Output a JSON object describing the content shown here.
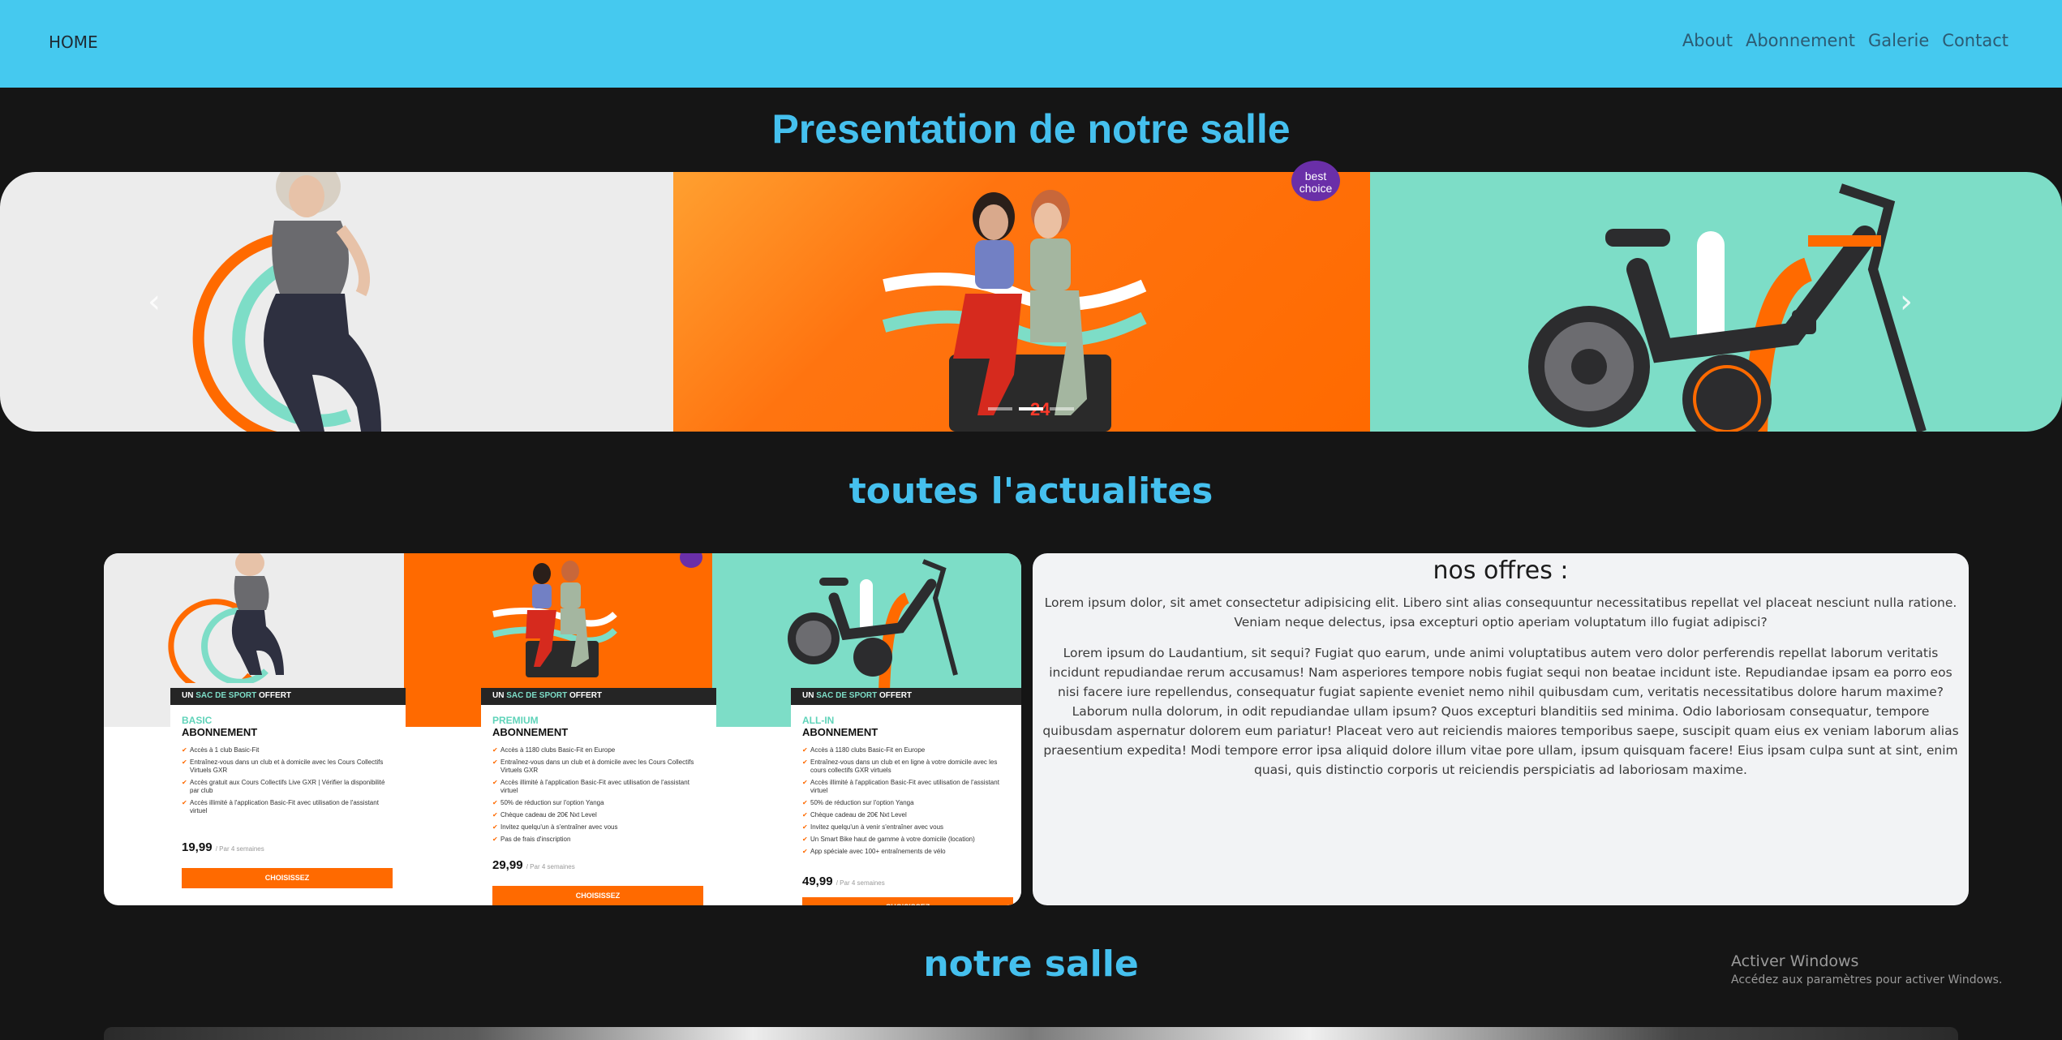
{
  "nav": {
    "home": "HOME",
    "links": [
      "About",
      "Abonnement",
      "Galerie",
      "Contact"
    ]
  },
  "sections": {
    "presentation": "Presentation de notre salle",
    "news": "toutes l'actualites",
    "gym": "notre salle"
  },
  "carousel": {
    "prev": "‹",
    "next": "›",
    "badge": "best choice",
    "slide_count": 3,
    "active_slide": 1,
    "colors": {
      "slide1": "#ececec",
      "slide2": "#ff6a00",
      "slide3": "#7dddc7"
    }
  },
  "offers": {
    "title": "nos offres :",
    "p1": "Lorem ipsum dolor, sit amet consectetur adipisicing elit. Libero sint alias consequuntur necessitatibus repellat vel placeat nesciunt nulla ratione. Veniam neque delectus, ipsa excepturi optio aperiam voluptatum illo fugiat adipisci?",
    "p2": "Lorem ipsum do Laudantium, sit sequi? Fugiat quo earum, unde animi voluptatibus autem vero dolor perferendis repellat laborum veritatis incidunt repudiandae rerum accusamus! Nam asperiores tempore nobis fugiat sequi non beatae incidunt iste. Repudiandae ipsam ea porro eos nisi facere iure repellendus, consequatur fugiat sapiente eveniet nemo nihil quibusdam cum, veritatis necessitatibus dolore harum maxime? Laborum nulla dolorum, in odit repudiandae ullam ipsum? Quos excepturi blanditiis sed minima. Odio laboriosam consequatur, tempore quibusdam aspernatur dolorem eum pariatur! Placeat vero aut reiciendis maiores temporibus saepe, suscipit quam eius ex veniam laborum alias praesentium expedita! Modi tempore error ipsa aliquid dolore illum vitae pore ullam, ipsum quisquam facere! Eius ipsam culpa sunt at sint, enim quasi, quis distinctio corporis ut reiciendis perspiciatis ad laboriosam maxime."
  },
  "plans": [
    {
      "head_pre": "UN ",
      "head_mid": "SAC DE SPORT",
      "head_post": " OFFERT",
      "tier": "BASIC",
      "kind": "ABONNEMENT",
      "features": [
        "Accès à 1 club Basic-Fit",
        "Entraînez-vous dans un club et à domicile avec les Cours Collectifs Virtuels GXR",
        "Accès gratuit aux Cours Collectifs Live GXR | Vérifier la disponibilité par club",
        "Accès illimité à l'application Basic-Fit avec utilisation de l'assistant virtuel"
      ],
      "price": "19,99",
      "period": "/ Par 4 semaines",
      "button": "CHOISISSEZ"
    },
    {
      "head_pre": "UN ",
      "head_mid": "SAC DE SPORT",
      "head_post": " OFFERT",
      "tier": "PREMIUM",
      "kind": "ABONNEMENT",
      "features": [
        "Accès à 1180 clubs Basic-Fit en Europe",
        "Entraînez-vous dans un club et à domicile avec les Cours Collectifs Virtuels GXR",
        "Accès illimité à l'application Basic-Fit avec utilisation de l'assistant virtuel",
        "50% de réduction sur l'option Yanga",
        "Chèque cadeau de 20€ Nxt Level",
        "Invitez quelqu'un à s'entraîner avec vous",
        "Pas de frais d'inscription"
      ],
      "price": "29,99",
      "period": "/ Par 4 semaines",
      "button": "CHOISISSEZ"
    },
    {
      "head_pre": "UN ",
      "head_mid": "SAC DE SPORT",
      "head_post": " OFFERT",
      "tier": "ALL-IN",
      "kind": "ABONNEMENT",
      "features": [
        "Accès à 1180 clubs Basic-Fit en Europe",
        "Entraînez-vous dans un club et en ligne à votre domicile avec les cours collectifs GXR virtuels",
        "Accès illimité à l'application Basic-Fit avec utilisation de l'assistant virtuel",
        "50% de réduction sur l'option Yanga",
        "Chèque cadeau de 20€ Nxt Level",
        "Invitez quelqu'un à venir s'entraîner avec vous",
        "Un Smart Bike haut de gamme à votre domicile (location)",
        "App spéciale avec 100+ entraînements de vélo"
      ],
      "price": "49,99",
      "period": "/ Par 4 semaines",
      "button": "CHOISISSEZ"
    }
  ],
  "watermark": {
    "line1": "Activer Windows",
    "line2": "Accédez aux paramètres pour activer Windows."
  }
}
